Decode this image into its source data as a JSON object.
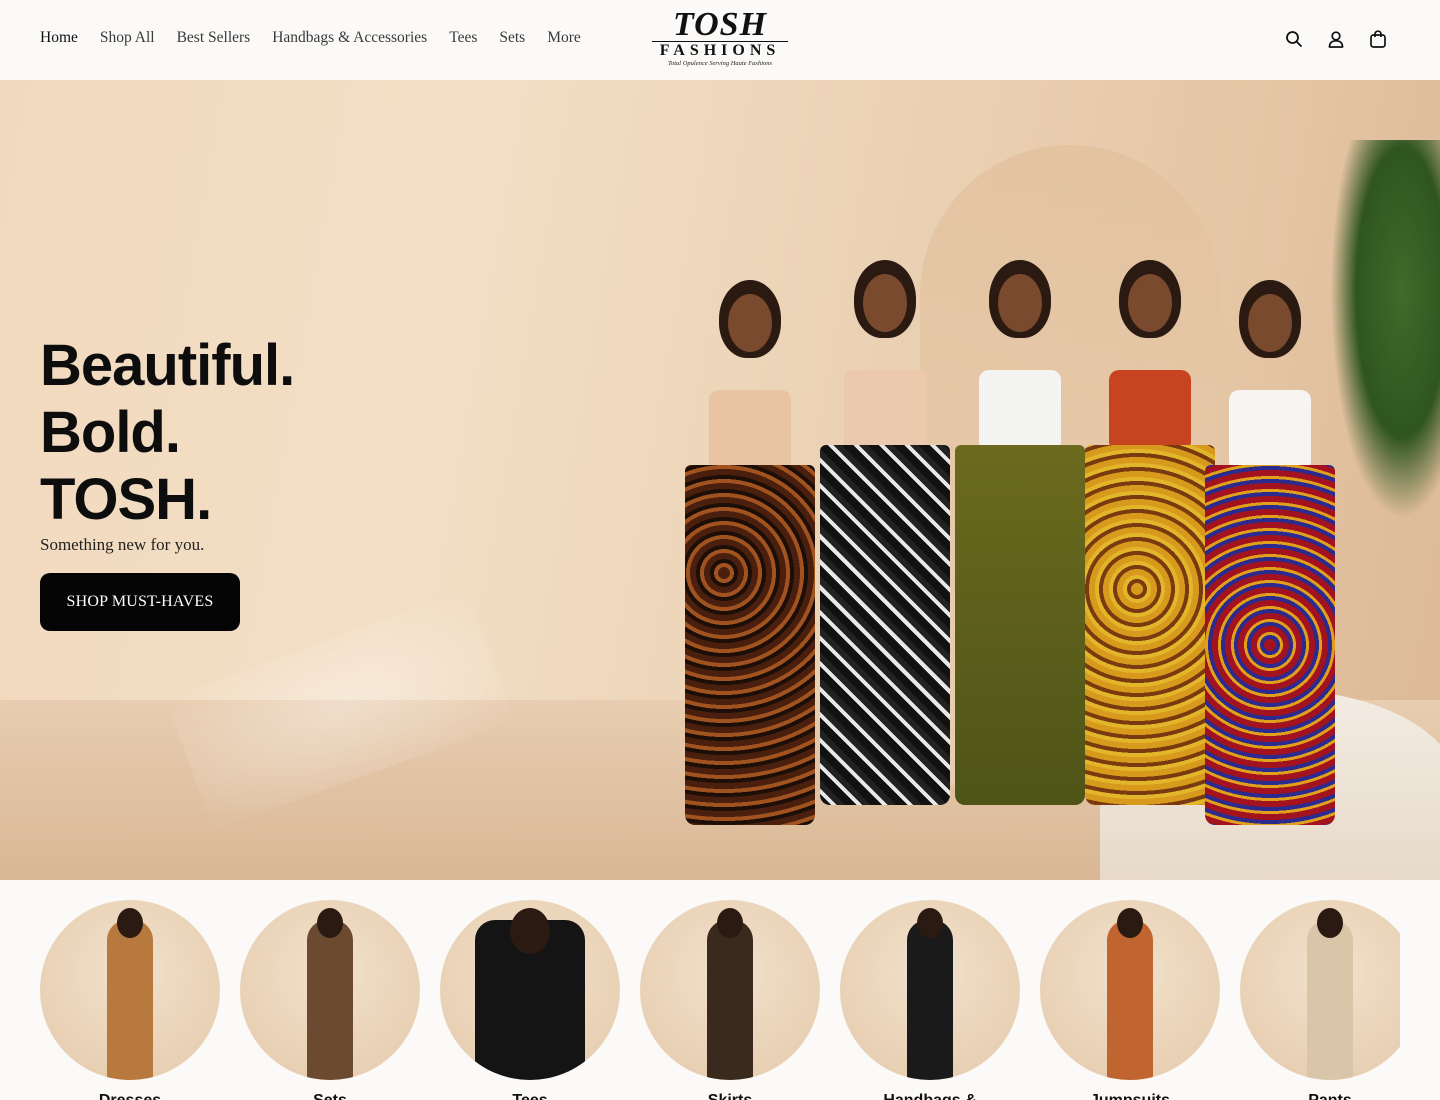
{
  "header": {
    "nav": [
      {
        "label": "Home"
      },
      {
        "label": "Shop All"
      },
      {
        "label": "Best Sellers"
      },
      {
        "label": "Handbags & Accessories"
      },
      {
        "label": "Tees"
      },
      {
        "label": "Sets"
      },
      {
        "label": "More"
      }
    ],
    "logo": {
      "brand": "TOSH",
      "sub": "FASHIONS",
      "tagline": "Total Opulence Serving Haute Fashions"
    },
    "icons": [
      "search-icon",
      "account-icon",
      "cart-icon"
    ]
  },
  "hero": {
    "headline_1": "Beautiful.",
    "headline_2": "Bold.",
    "headline_3": "TOSH.",
    "subtext": "Something new for you.",
    "cta_label": "SHOP MUST-HAVES"
  },
  "categories": [
    {
      "label": "Dresses",
      "color": "#b8793e"
    },
    {
      "label": "Sets",
      "color": "#6b4a2f"
    },
    {
      "label": "Tees",
      "color": "#141414"
    },
    {
      "label": "Skirts",
      "color": "#3a2a1e"
    },
    {
      "label": "Handbags & Accessories",
      "color": "#1a1a1a"
    },
    {
      "label": "Jumpsuits",
      "color": "#c0652f"
    },
    {
      "label": "Pants",
      "color": "#d9c6a8"
    }
  ],
  "colors": {
    "accent": "#050505",
    "background": "#fbfaf8"
  }
}
